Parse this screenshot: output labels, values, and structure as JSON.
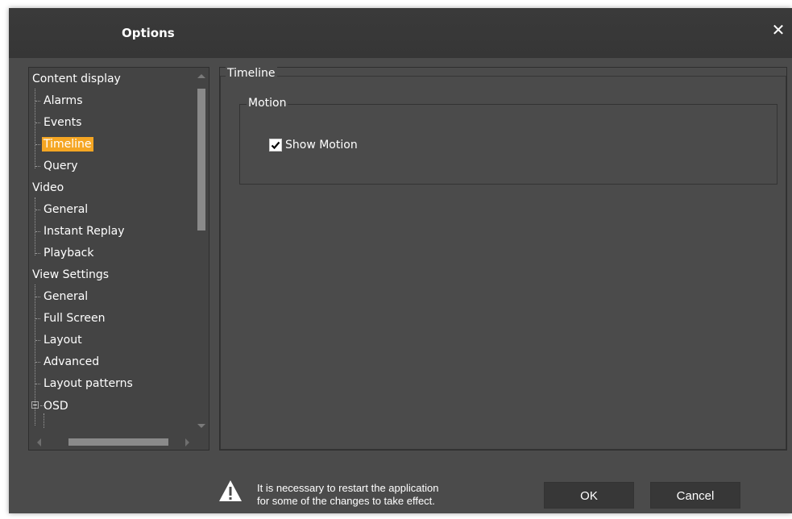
{
  "window": {
    "title": "Options",
    "close_icon": "close-icon"
  },
  "tree": {
    "sections": [
      {
        "label": "Content display",
        "items": [
          {
            "label": "Alarms"
          },
          {
            "label": "Events"
          },
          {
            "label": "Timeline",
            "selected": true
          },
          {
            "label": "Query"
          }
        ]
      },
      {
        "label": "Video",
        "items": [
          {
            "label": "General"
          },
          {
            "label": "Instant Replay"
          },
          {
            "label": "Playback"
          }
        ]
      },
      {
        "label": "View Settings",
        "items": [
          {
            "label": "General"
          },
          {
            "label": "Full Screen"
          },
          {
            "label": "Layout"
          },
          {
            "label": "Advanced"
          },
          {
            "label": "Layout patterns"
          }
        ]
      }
    ],
    "osd_label": "OSD",
    "selected_color": "#f5a623"
  },
  "panel": {
    "title": "Timeline",
    "motion_group": {
      "title": "Motion",
      "show_motion_label": "Show Motion",
      "show_motion_checked": true
    }
  },
  "footer": {
    "warning_line1": "It is necessary to restart the application",
    "warning_line2": "for some of the changes to take effect.",
    "warning_icon": "warning-icon",
    "ok_label": "OK",
    "cancel_label": "Cancel"
  }
}
